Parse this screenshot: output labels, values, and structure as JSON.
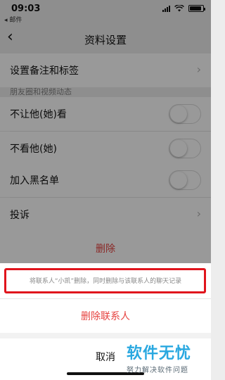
{
  "status_bar": {
    "time": "09:03",
    "carrier": "◂ 邮件"
  },
  "nav": {
    "back_icon": "chevron-left-icon",
    "back_glyph": "‹",
    "title": "资料设置"
  },
  "settings": {
    "remark": "设置备注和标签",
    "moments_header": "朋友圈和视频动态",
    "hide_my_moments": "不让他(她)看",
    "hide_their_moments": "不看他(她)",
    "blacklist": "加入黑名单",
    "complain": "投诉",
    "delete": "删除",
    "arrow": "›"
  },
  "sheet": {
    "description": "将联系人“小凯”删除，同时删除与该联系人的聊天记录",
    "delete_contact": "删除联系人",
    "cancel": "取消"
  },
  "watermark": {
    "title": "软件无忧",
    "subtitle": "努力解决软件问题"
  },
  "colors": {
    "danger": "#e64340",
    "highlight": "#e0141c",
    "watermark": "#29a8e0"
  }
}
